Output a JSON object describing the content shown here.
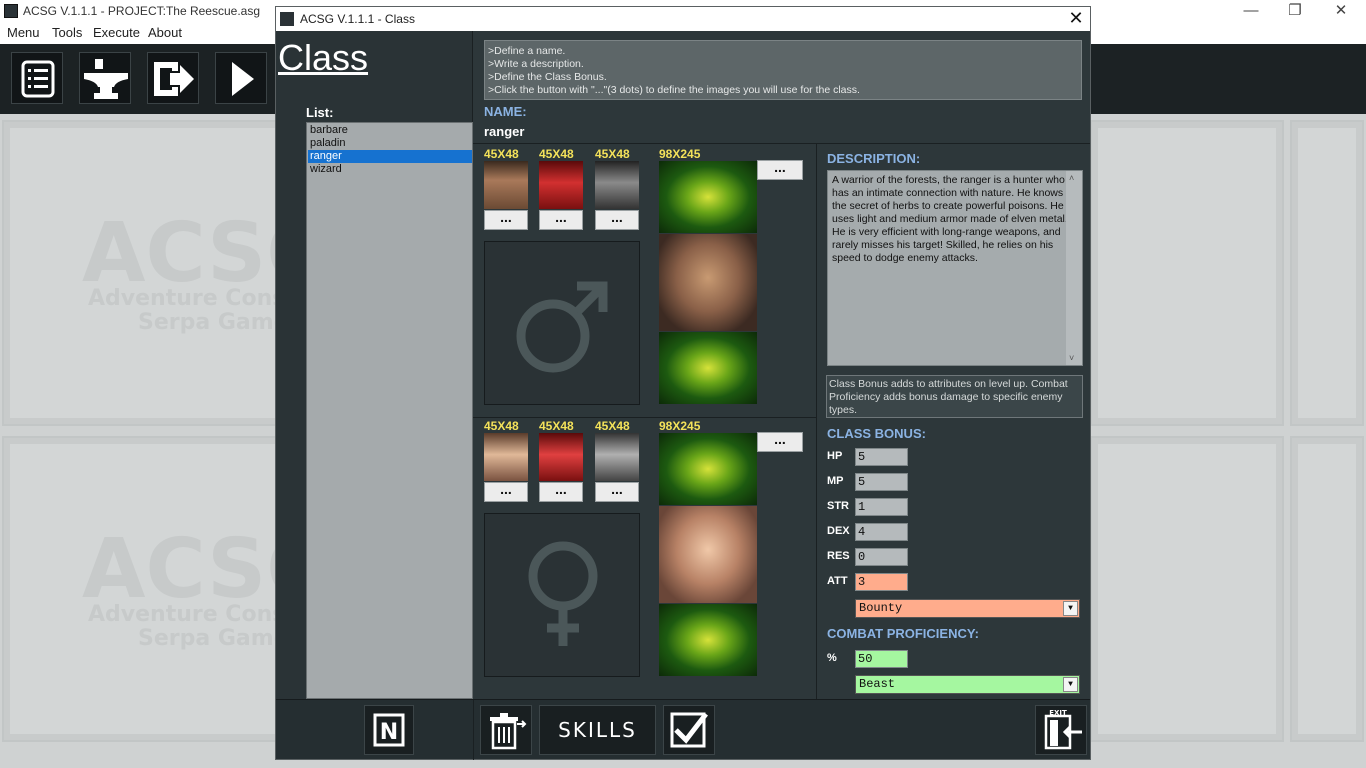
{
  "app": {
    "window_title": "ACSG V.1.1.1 - PROJECT:The Reescue.asg",
    "menu": [
      "Menu",
      "Tools",
      "Execute",
      "About"
    ]
  },
  "icons": [
    "list-icon",
    "anvil-icon",
    "enter-icon",
    "play-icon",
    "male-symbol-icon",
    "female-symbol-icon",
    "new-icon",
    "trash-icon",
    "checkmark-icon",
    "exit-icon"
  ],
  "background": {
    "logo_text": "ACSG",
    "logo_sub1": "Adventure Construct",
    "logo_sub2": "Serpa Games"
  },
  "dialog": {
    "title": "ACSG V.1.1.1 - Class",
    "heading": "Class",
    "list_label": "List:",
    "class_list": [
      "barbare",
      "paladin",
      "ranger",
      "wizard"
    ],
    "selected_class": "ranger",
    "instructions": [
      ">Define a name.",
      ">Write a description.",
      ">Define the Class Bonus.",
      ">Click the button with \"...\"(3 dots) to define the images you will use for the class."
    ],
    "name_label": "NAME:",
    "name_value": "ranger",
    "image_sizes": {
      "small": "45X48",
      "large": "98X245"
    },
    "dots_label": "...",
    "description_label": "DESCRIPTION:",
    "description": "A warrior of the forests, the ranger is a hunter who has an intimate connection with nature. He knows the secret of herbs to create powerful poisons. He uses light and medium armor made of elven metal. He is very efficient with long-range weapons, and rarely misses his target! Skilled, he relies on his speed to dodge enemy attacks.",
    "bonus_info": "Class Bonus adds to attributes on level up. Combat Proficiency adds bonus damage to specific enemy types.",
    "class_bonus_label": "CLASS BONUS:",
    "stats": {
      "hp": {
        "label": "HP",
        "value": "5"
      },
      "mp": {
        "label": "MP",
        "value": "5"
      },
      "str": {
        "label": "STR",
        "value": "1"
      },
      "dex": {
        "label": "DEX",
        "value": "4"
      },
      "res": {
        "label": "RES",
        "value": "0"
      },
      "att": {
        "label": "ATT",
        "value": "3"
      }
    },
    "att_type": "Bounty",
    "combat_proficiency_label": "COMBAT PROFICIENCY:",
    "proficiency": {
      "label": "%",
      "value": "50",
      "enemy_type": "Beast"
    },
    "skills_button": "SKILLS",
    "new_button": "N",
    "exit_text": "EXIT"
  },
  "colors": {
    "accent_blue": "#8bb3e3",
    "size_yellow": "#f4e25a",
    "att_orange": "#ffac8c",
    "proficiency_green": "#a5f7a0",
    "selection_blue": "#1672d0"
  }
}
